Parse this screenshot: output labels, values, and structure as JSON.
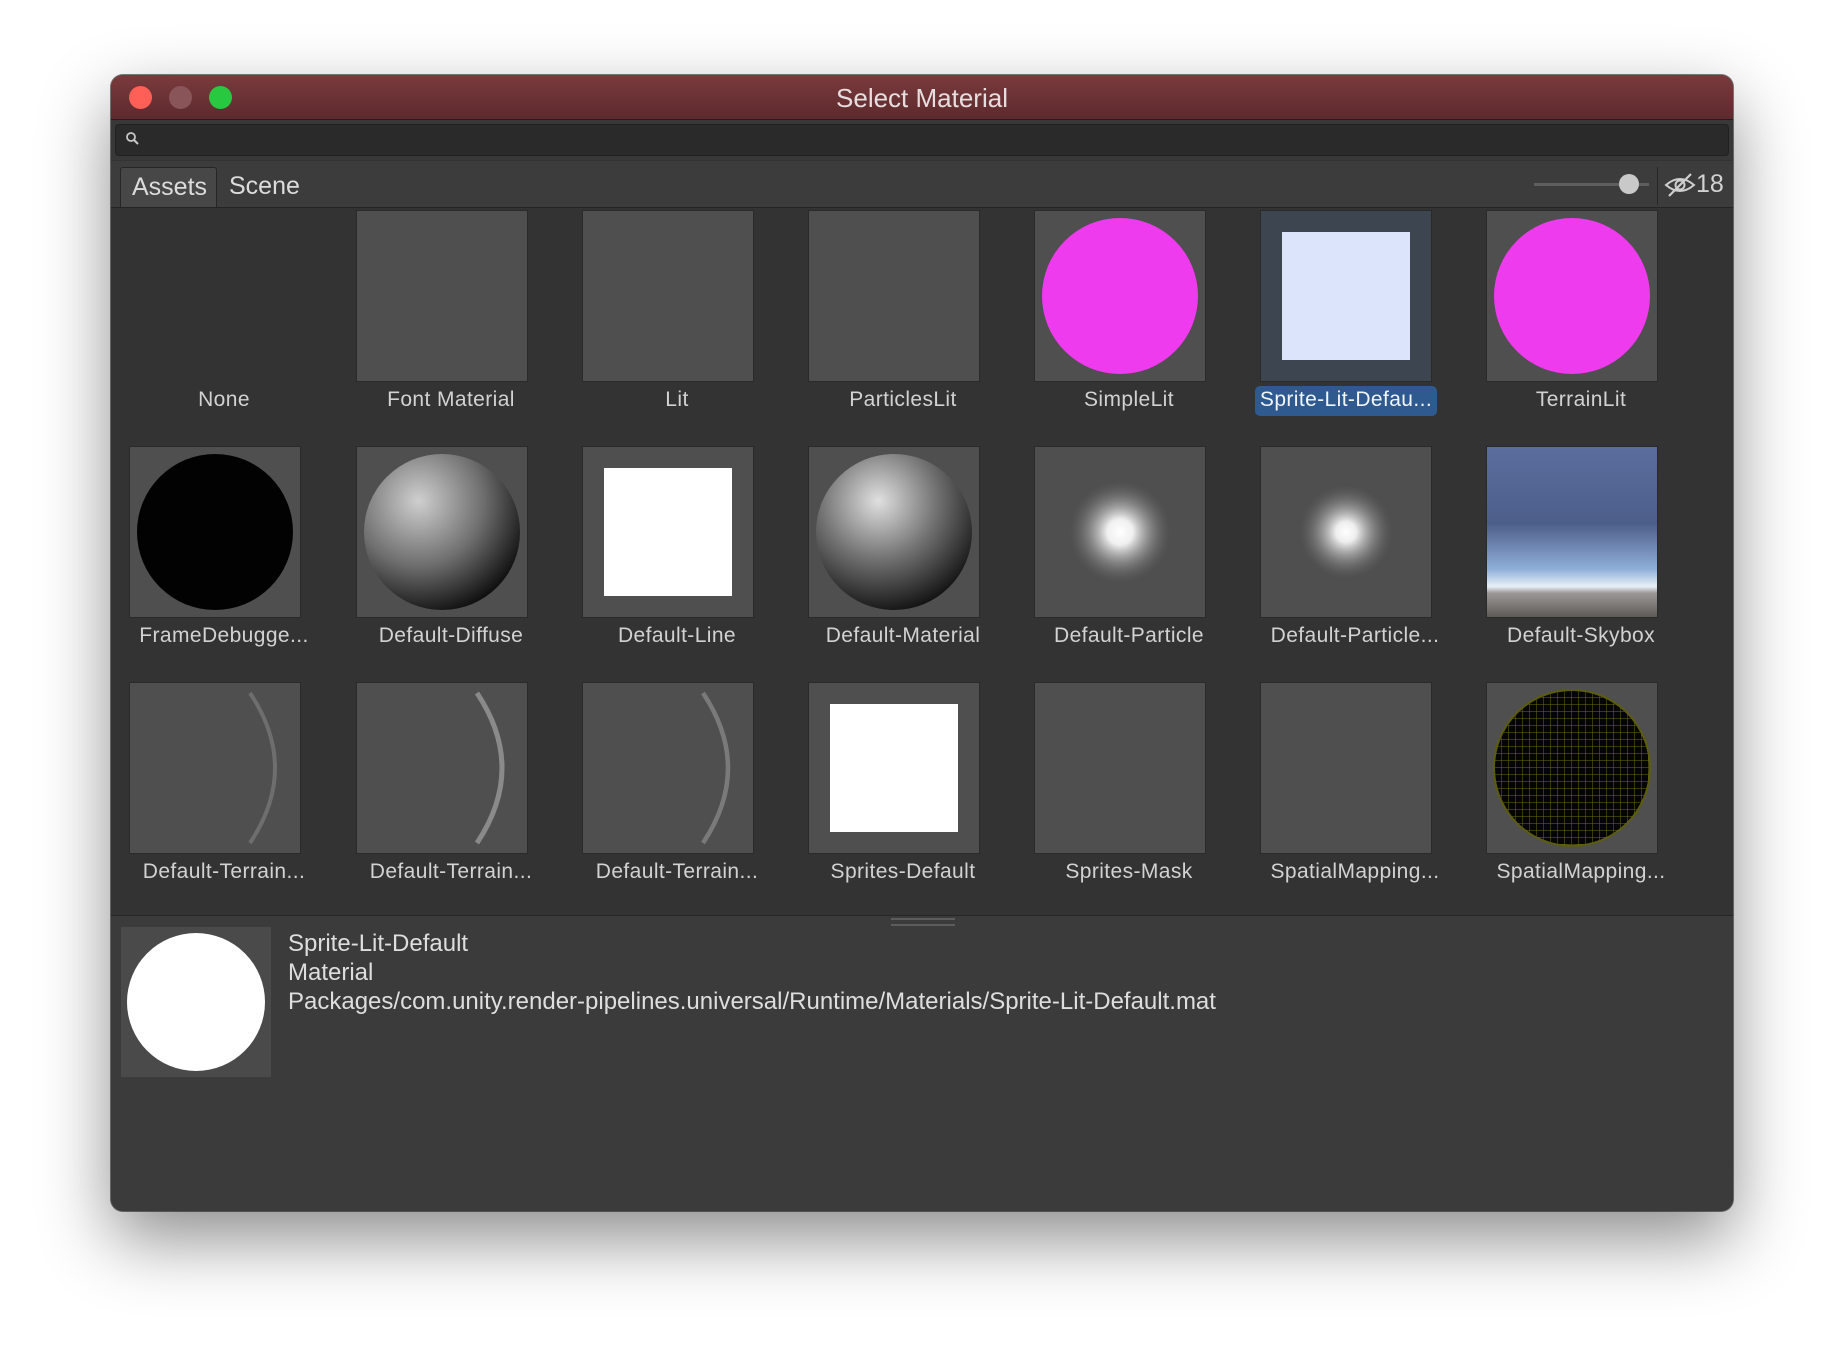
{
  "window": {
    "title": "Select Material"
  },
  "search": {
    "value": ""
  },
  "tabs": [
    {
      "label": "Assets",
      "active": true
    },
    {
      "label": "Scene",
      "active": false
    }
  ],
  "toolbar": {
    "hidden_count": "18",
    "hidden_icon": "eye-slash-icon"
  },
  "items": [
    {
      "label": "None",
      "thumb": "none"
    },
    {
      "label": "Font Material",
      "thumb": "empty"
    },
    {
      "label": "Lit",
      "thumb": "empty"
    },
    {
      "label": "ParticlesLit",
      "thumb": "empty"
    },
    {
      "label": "SimpleLit",
      "thumb": "magenta-sphere"
    },
    {
      "label": "Sprite-Lit-Defau...",
      "thumb": "pale-square",
      "selected": true
    },
    {
      "label": "TerrainLit",
      "thumb": "magenta-sphere"
    },
    {
      "label": "FrameDebugge...",
      "thumb": "black-sphere"
    },
    {
      "label": "Default-Diffuse",
      "thumb": "grey-sphere"
    },
    {
      "label": "Default-Line",
      "thumb": "white-square"
    },
    {
      "label": "Default-Material",
      "thumb": "grey-sphere"
    },
    {
      "label": "Default-Particle",
      "thumb": "glow"
    },
    {
      "label": "Default-Particle...",
      "thumb": "glow"
    },
    {
      "label": "Default-Skybox",
      "thumb": "skybox"
    },
    {
      "label": "Default-Terrain...",
      "thumb": "crescent"
    },
    {
      "label": "Default-Terrain...",
      "thumb": "crescent"
    },
    {
      "label": "Default-Terrain...",
      "thumb": "crescent"
    },
    {
      "label": "Sprites-Default",
      "thumb": "white-square"
    },
    {
      "label": "Sprites-Mask",
      "thumb": "empty"
    },
    {
      "label": "SpatialMapping...",
      "thumb": "empty"
    },
    {
      "label": "SpatialMapping...",
      "thumb": "wire-sphere"
    }
  ],
  "colors": {
    "magenta": "#ee3bee",
    "selection": "#2e5a8f",
    "titlebar": "#6b3336"
  },
  "preview": {
    "name": "Sprite-Lit-Default",
    "type": "Material",
    "path": "Packages/com.unity.render-pipelines.universal/Runtime/Materials/Sprite-Lit-Default.mat"
  }
}
